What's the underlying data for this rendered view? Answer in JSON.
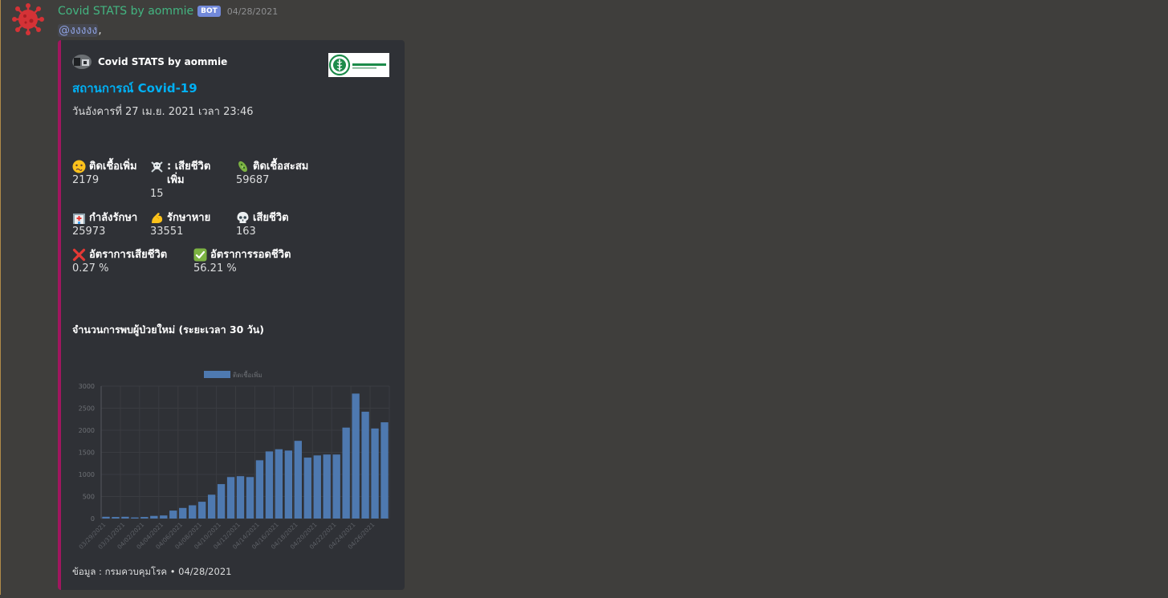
{
  "message": {
    "author": "Covid STATS by aommie",
    "bot_tag": "BOT",
    "timestamp": "04/28/2021",
    "mention": "@งงงงง",
    "mention_suffix": ","
  },
  "embed": {
    "accent_color": "#a1165f",
    "author_name": "Covid STATS by aommie",
    "title": "สถานการณ์ Covid-19",
    "description": "วันอังคารที่ 27 เม.ย. 2021 เวลา 23:46",
    "fields": [
      {
        "name": "ติดเชื้อเพิ่ม",
        "value": "2179",
        "icon": "confused-face-icon"
      },
      {
        "name": ": เสียชีวิตเพิ่ม",
        "value": "15",
        "icon": "skull-crossbones-icon"
      },
      {
        "name": "ติดเชื้อสะสม",
        "value": "59687",
        "icon": "microbe-icon"
      },
      {
        "name": "กำลังรักษา",
        "value": "25973",
        "icon": "hospital-icon"
      },
      {
        "name": "รักษาหาย",
        "value": "33551",
        "icon": "flexed-biceps-icon"
      },
      {
        "name": "เสียชีวิต",
        "value": "163",
        "icon": "skull-icon"
      },
      {
        "name": "อัตราการเสียชีวิต",
        "value": "0.27 %",
        "icon": "cross-mark-icon"
      },
      {
        "name": "อัตราการรอดชีวิต",
        "value": "56.21 %",
        "icon": "check-mark-icon"
      }
    ],
    "chart_title": "จำนวนการพบผู้ป่วยใหม่ (ระยะเวลา 30 วัน)",
    "footer": "ข้อมูล : กรมควบคุมโรค • 04/28/2021"
  },
  "chart_data": {
    "type": "bar",
    "legend": "ติดเชื้อเพิ่ม",
    "legend_position": "top",
    "grid": true,
    "bar_color": "#4e79b0",
    "ylim": [
      0,
      3000
    ],
    "yticks": [
      0,
      500,
      1000,
      1500,
      2000,
      2500,
      3000
    ],
    "xticklabels": [
      "03/29/2021",
      "03/31/2021",
      "04/02/2021",
      "04/04/2021",
      "04/06/2021",
      "04/08/2021",
      "04/10/2021",
      "04/12/2021",
      "04/14/2021",
      "04/16/2021",
      "04/18/2021",
      "04/20/2021",
      "04/22/2021",
      "04/24/2021",
      "04/26/2021"
    ],
    "categories": [
      "03/29/2021",
      "03/30/2021",
      "03/31/2021",
      "04/01/2021",
      "04/02/2021",
      "04/03/2021",
      "04/04/2021",
      "04/05/2021",
      "04/06/2021",
      "04/07/2021",
      "04/08/2021",
      "04/09/2021",
      "04/10/2021",
      "04/11/2021",
      "04/12/2021",
      "04/13/2021",
      "04/14/2021",
      "04/15/2021",
      "04/16/2021",
      "04/17/2021",
      "04/18/2021",
      "04/19/2021",
      "04/20/2021",
      "04/21/2021",
      "04/22/2021",
      "04/23/2021",
      "04/24/2021",
      "04/25/2021",
      "04/26/2021",
      "04/27/2021"
    ],
    "values": [
      40,
      35,
      40,
      25,
      35,
      60,
      70,
      180,
      240,
      300,
      380,
      540,
      780,
      940,
      960,
      940,
      1320,
      1520,
      1570,
      1540,
      1760,
      1380,
      1430,
      1450,
      1450,
      2060,
      2830,
      2420,
      2040,
      2180
    ]
  }
}
